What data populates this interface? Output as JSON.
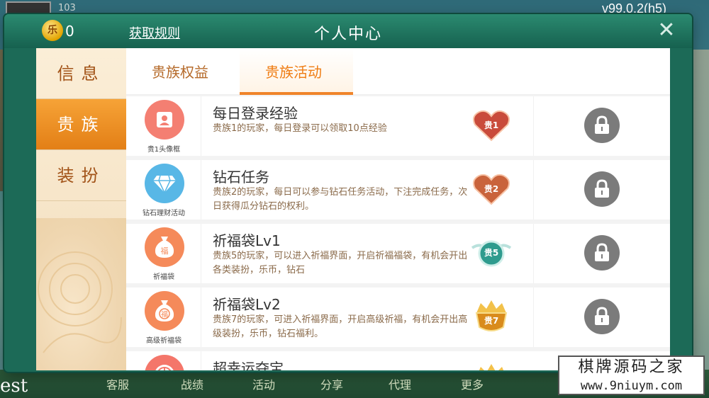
{
  "background": {
    "coins": "103",
    "version": "v99.0.2(h5)",
    "nav_items": [
      "客服",
      "战绩",
      "活动",
      "分享",
      "代理",
      "更多"
    ],
    "stray_text": "est"
  },
  "header": {
    "coin_badge": "乐",
    "coin_value": "0",
    "rules_link": "获取规则",
    "title": "个人中心",
    "close": "✕"
  },
  "sidebar": {
    "tabs": [
      {
        "label": "信息",
        "active": false
      },
      {
        "label": "贵族",
        "active": true
      },
      {
        "label": "装扮",
        "active": false
      }
    ]
  },
  "main": {
    "tabs": [
      {
        "label": "贵族权益",
        "active": false
      },
      {
        "label": "贵族活动",
        "active": true
      }
    ],
    "rows": [
      {
        "icon": "avatar-frame-icon",
        "icon_color": "#f47f72",
        "icon_label": "贵1头像框",
        "title": "每日登录经验",
        "desc": "贵族1的玩家，每日登录可以领取10点经验",
        "badge": "贵1",
        "badge_color": "#c94b3b",
        "locked": true
      },
      {
        "icon": "diamond-icon",
        "icon_color": "#58b7e6",
        "icon_label": "钻石理财活动",
        "title": "钻石任务",
        "desc": "贵族2的玩家，每日可以参与钻石任务活动，下注完成任务，次日获得瓜分钻石的权利。",
        "badge": "贵2",
        "badge_color": "#c9633b",
        "locked": true
      },
      {
        "icon": "lucky-bag-icon",
        "icon_color": "#f58a5a",
        "icon_label": "祈福袋",
        "title": "祈福袋Lv1",
        "desc": "贵族5的玩家，可以进入祈福界面，开启祈福福袋，有机会开出各类装扮，乐币，钻石",
        "badge": "贵5",
        "badge_color": "#2f9b8e",
        "locked": true
      },
      {
        "icon": "premium-lucky-bag-icon",
        "icon_color": "#f58a5a",
        "icon_label": "高级祈福袋",
        "title": "祈福袋Lv2",
        "desc": "贵族7的玩家，可进入祈福界面，开启高级祈福，有机会开出高级装扮，乐币，钻石福利。",
        "badge": "贵7",
        "badge_color": "#d98b1c",
        "locked": true
      },
      {
        "icon": "lucky-wheel-icon",
        "icon_color": "#f4766a",
        "icon_label": "",
        "title": "超幸运夺宝",
        "desc": "",
        "badge": "",
        "badge_color": "#d98b1c",
        "locked": true
      }
    ]
  },
  "watermark": {
    "line1": "棋牌源码之家",
    "line2": "www.9niuym.com"
  }
}
